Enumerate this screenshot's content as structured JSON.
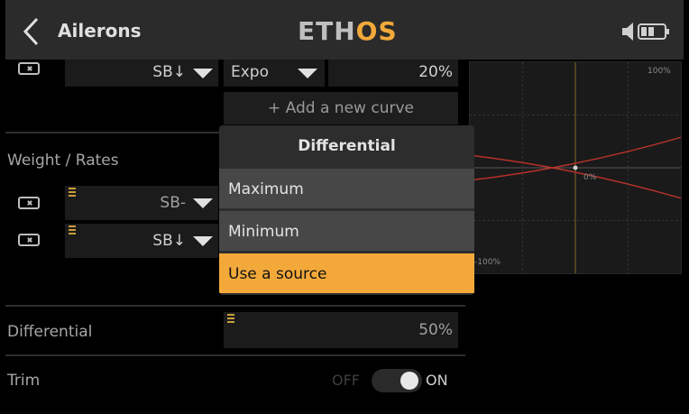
{
  "header": {
    "title": "Ailerons",
    "logo_main": "ETH",
    "logo_accent": "OS",
    "icons": [
      "back-chevron-icon",
      "volume-icon",
      "battery-icon"
    ]
  },
  "expo_row": {
    "source": "SB↓",
    "curve_type": "Expo",
    "value": "20%"
  },
  "add_curve_button": "+ Add a new curve",
  "weight_rates": {
    "label": "Weight / Rates",
    "rows": [
      {
        "source": "SB-"
      },
      {
        "source": "SB↓"
      }
    ]
  },
  "differential_row": {
    "label": "Differential",
    "value": "50%"
  },
  "trim_row": {
    "label": "Trim",
    "off_label": "OFF",
    "on_label": "ON",
    "state": "on"
  },
  "graph": {
    "top_label": "100%",
    "mid_label": "0%",
    "bottom_label": "-100%"
  },
  "popup": {
    "title": "Differential",
    "items": [
      "Maximum",
      "Minimum",
      "Use a source"
    ],
    "selected": "Use a source"
  },
  "colors": {
    "accent": "#f3a93a",
    "background": "#000000",
    "header": "#2b2b2b",
    "curve": "#c0392b"
  }
}
